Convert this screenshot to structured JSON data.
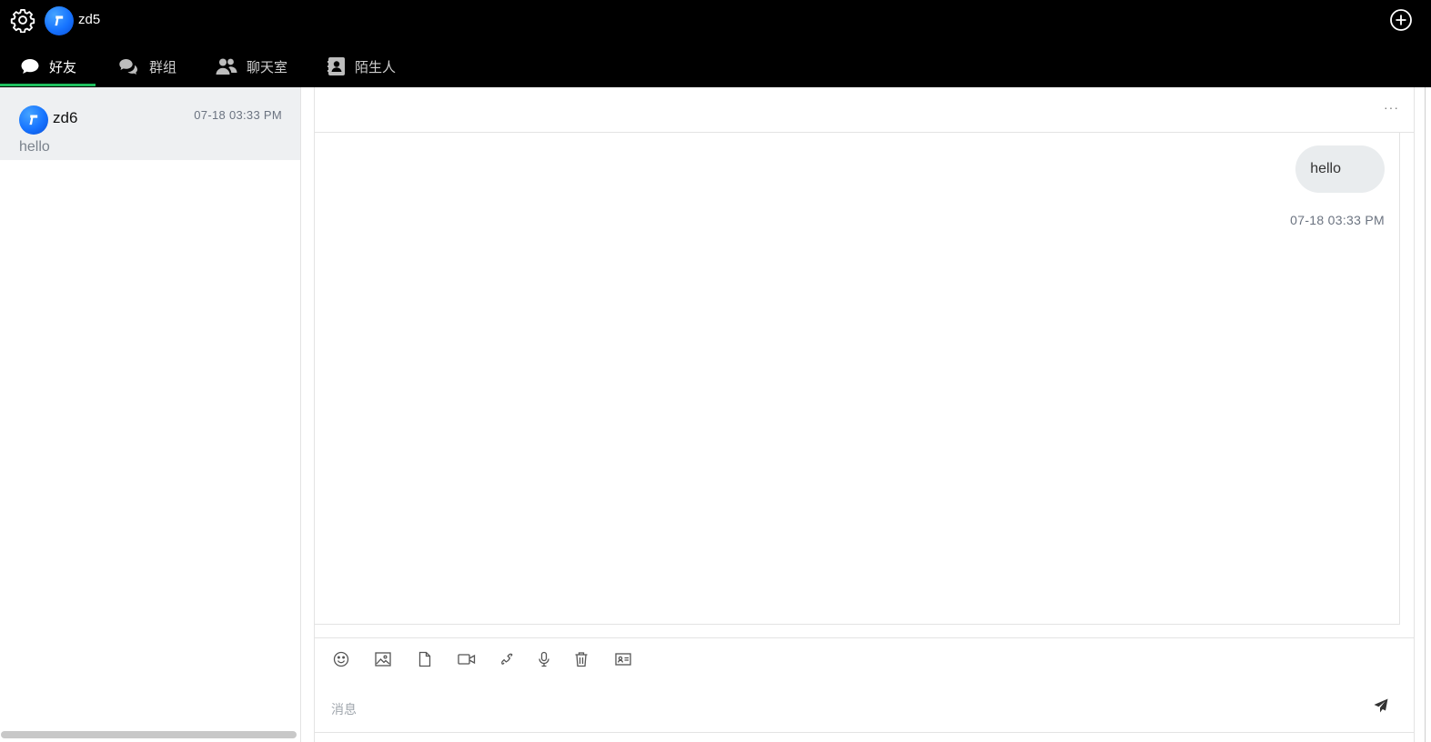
{
  "topbar": {
    "username": "zd5",
    "icons": {
      "settings": "gear-icon",
      "add": "plus-circle-icon",
      "avatar": "app-logo-avatar"
    }
  },
  "tabs": [
    {
      "label": "好友",
      "icon": "chat-bubble-icon",
      "active": true
    },
    {
      "label": "群组",
      "icon": "chat-bubbles-icon",
      "active": false
    },
    {
      "label": "聊天室",
      "icon": "users-icon",
      "active": false
    },
    {
      "label": "陌生人",
      "icon": "contact-card-icon",
      "active": false
    }
  ],
  "conversations": [
    {
      "name": "zd6",
      "time": "07-18 03:33 PM",
      "preview": "hello"
    }
  ],
  "chat": {
    "more_label": "···",
    "messages": [
      {
        "text": "hello",
        "time": "07-18 03:33 PM",
        "direction": "outgoing"
      }
    ],
    "toolbar": [
      "emoji-icon",
      "image-icon",
      "file-icon",
      "video-call-icon",
      "phone-icon",
      "microphone-icon",
      "trash-icon",
      "contact-card-icon"
    ],
    "input": {
      "placeholder": "消息",
      "value": ""
    },
    "send_icon": "send-icon"
  },
  "colors": {
    "topbar_bg": "#000000",
    "tab_active_underline": "#1fbf5f",
    "avatar_blue": "#1673ff",
    "selected_conv_bg": "#eef0f2",
    "bubble_bg": "#e9ecee"
  }
}
